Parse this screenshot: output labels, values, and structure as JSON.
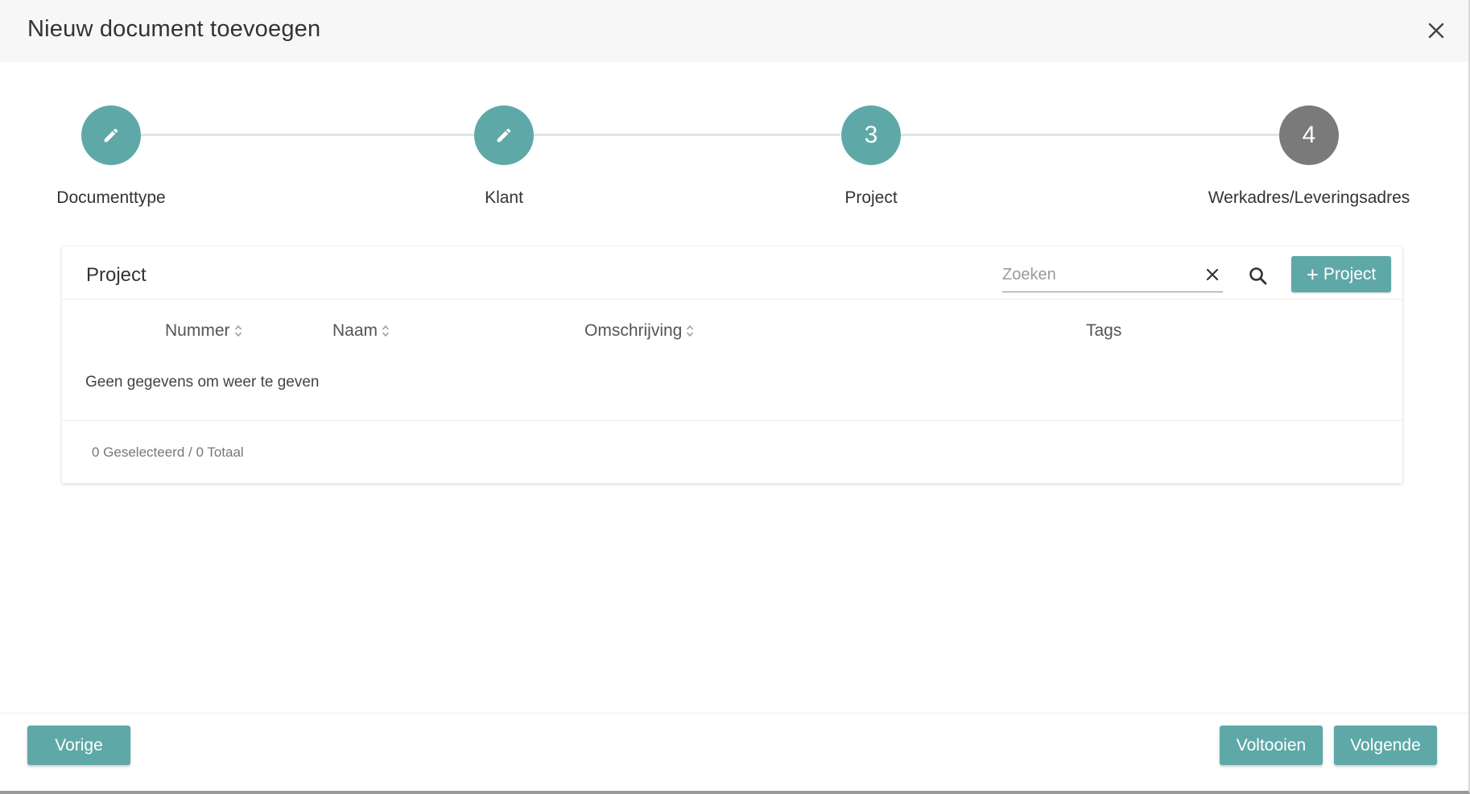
{
  "dialog": {
    "title": "Nieuw document toevoegen"
  },
  "stepper": {
    "steps": [
      {
        "label": "Documenttype",
        "state": "completed",
        "icon": "pencil-icon"
      },
      {
        "label": "Klant",
        "state": "completed",
        "icon": "pencil-icon"
      },
      {
        "label": "Project",
        "state": "active",
        "number": "3"
      },
      {
        "label": "Werkadres/Leveringsadres",
        "state": "upcoming",
        "number": "4"
      }
    ]
  },
  "project_table": {
    "title": "Project",
    "search": {
      "placeholder": "Zoeken",
      "value": ""
    },
    "add_button_label": "Project",
    "columns": [
      "Nummer",
      "Naam",
      "Omschrijving",
      "Tags"
    ],
    "empty_message": "Geen gegevens om weer te geven",
    "footer_count": "0 Geselecteerd / 0 Totaal"
  },
  "footer": {
    "prev_label": "Vorige",
    "finish_label": "Voltooien",
    "next_label": "Volgende"
  },
  "colors": {
    "accent": "#5fa8a8",
    "inactive_step": "#7a7a7a"
  }
}
